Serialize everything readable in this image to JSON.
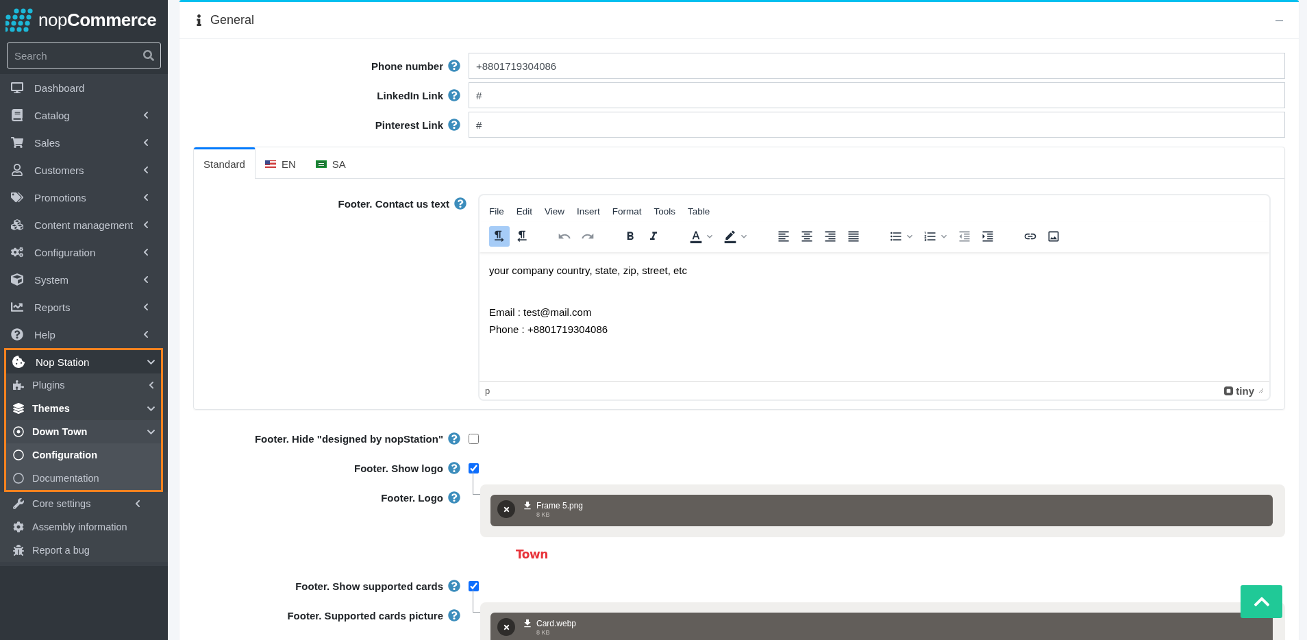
{
  "brand": "nop**Commerce**",
  "search": {
    "placeholder": "Search"
  },
  "sidebar": {
    "items": [
      {
        "label": "Dashboard",
        "active": false
      },
      {
        "label": "Catalog",
        "active": false,
        "expanded": false
      },
      {
        "label": "Sales",
        "active": false,
        "expanded": false
      },
      {
        "label": "Customers",
        "active": false,
        "expanded": false
      },
      {
        "label": "Promotions",
        "active": false,
        "expanded": false
      },
      {
        "label": "Content management",
        "active": false,
        "expanded": false
      },
      {
        "label": "Configuration",
        "active": false,
        "expanded": false
      },
      {
        "label": "System",
        "active": false,
        "expanded": false
      },
      {
        "label": "Reports",
        "active": false,
        "expanded": false
      },
      {
        "label": "Help",
        "active": false,
        "expanded": false
      },
      {
        "label": "Nop Station",
        "active": true,
        "expanded": true,
        "highlighted": true,
        "children": [
          {
            "label": "Plugins",
            "active": false,
            "expanded": false,
            "highlighted": true
          },
          {
            "label": "Themes",
            "active": true,
            "expanded": true,
            "highlighted": true,
            "children": [
              {
                "label": "Down Town",
                "active": true,
                "expanded": true,
                "highlighted": true,
                "children": [
                  {
                    "label": "Configuration",
                    "active": true,
                    "highlighted": true
                  },
                  {
                    "label": "Documentation",
                    "active": false,
                    "highlighted": true
                  }
                ]
              }
            ]
          },
          {
            "label": "Core settings",
            "active": false,
            "expanded": false,
            "highlighted": false
          },
          {
            "label": "Assembly information",
            "active": false,
            "highlighted": false
          },
          {
            "label": "Report a bug",
            "active": false,
            "highlighted": false
          }
        ]
      }
    ]
  },
  "card": {
    "title": "General",
    "fields_top": [
      {
        "kind": "text",
        "label": "Phone number",
        "value": "+8801719304086"
      },
      {
        "kind": "text",
        "label": "LinkedIn Link",
        "value": "#"
      },
      {
        "kind": "text",
        "label": "Pinterest Link",
        "value": "#"
      }
    ],
    "tabs": [
      {
        "label": "Standard",
        "selected": true
      },
      {
        "label": "EN",
        "selected": false
      },
      {
        "label": "SA",
        "selected": false
      }
    ],
    "editor": {
      "label": "Footer. Contact us text",
      "menus": [
        "File",
        "Edit",
        "View",
        "Insert",
        "Format",
        "Tools",
        "Table"
      ],
      "toolbar_groups": [
        {
          "buttons": [
            {
              "kind": "button",
              "pressed": true,
              "disabled": false
            },
            {
              "kind": "button",
              "pressed": false,
              "disabled": false
            }
          ]
        },
        {
          "buttons": [
            {
              "kind": "button",
              "pressed": false,
              "disabled": true
            },
            {
              "kind": "button",
              "pressed": false,
              "disabled": true
            }
          ]
        },
        {
          "buttons": [
            {
              "kind": "button",
              "pressed": false,
              "disabled": false
            },
            {
              "kind": "button",
              "pressed": false,
              "disabled": false
            }
          ]
        },
        {
          "buttons": [
            {
              "kind": "split",
              "pressed": false,
              "disabled": false
            },
            {
              "kind": "split",
              "pressed": false,
              "disabled": false
            }
          ]
        },
        {
          "buttons": [
            {
              "kind": "button",
              "pressed": false,
              "disabled": false
            },
            {
              "kind": "button",
              "pressed": false,
              "disabled": false
            },
            {
              "kind": "button",
              "pressed": false,
              "disabled": false
            },
            {
              "kind": "button",
              "pressed": false,
              "disabled": false
            }
          ]
        },
        {
          "buttons": [
            {
              "kind": "split",
              "pressed": false,
              "disabled": false
            },
            {
              "kind": "split",
              "pressed": false,
              "disabled": false
            },
            {
              "kind": "button",
              "pressed": false,
              "disabled": true
            },
            {
              "kind": "button",
              "pressed": false,
              "disabled": false
            }
          ]
        },
        {
          "buttons": [
            {
              "kind": "button",
              "pressed": false,
              "disabled": false
            },
            {
              "kind": "button",
              "pressed": false,
              "disabled": false
            }
          ]
        }
      ],
      "paragraphs": [
        {
          "text": "your company country, state, zip, street, etc",
          "space_before": false
        },
        {
          "text": "Email : test@mail.com",
          "space_before": true
        },
        {
          "text": "Phone : +8801719304086",
          "space_before": false
        }
      ],
      "status_path": "p",
      "logo": "tiny"
    },
    "fields_bottom": [
      {
        "kind": "checkbox",
        "label": "Footer. Hide \"designed by nopStation\"",
        "checked": false
      },
      {
        "kind": "checkbox",
        "label": "Footer. Show logo",
        "checked": true
      },
      {
        "kind": "upload",
        "label": "Footer. Logo",
        "file": {
          "name": "Frame 5.png",
          "size": "8 KB"
        },
        "preview": "Town"
      },
      {
        "kind": "checkbox",
        "label": "Footer. Show supported cards",
        "checked": true
      },
      {
        "kind": "upload",
        "label": "Footer. Supported cards picture",
        "file": {
          "name": "Card.webp",
          "size": "8 KB"
        }
      }
    ]
  }
}
